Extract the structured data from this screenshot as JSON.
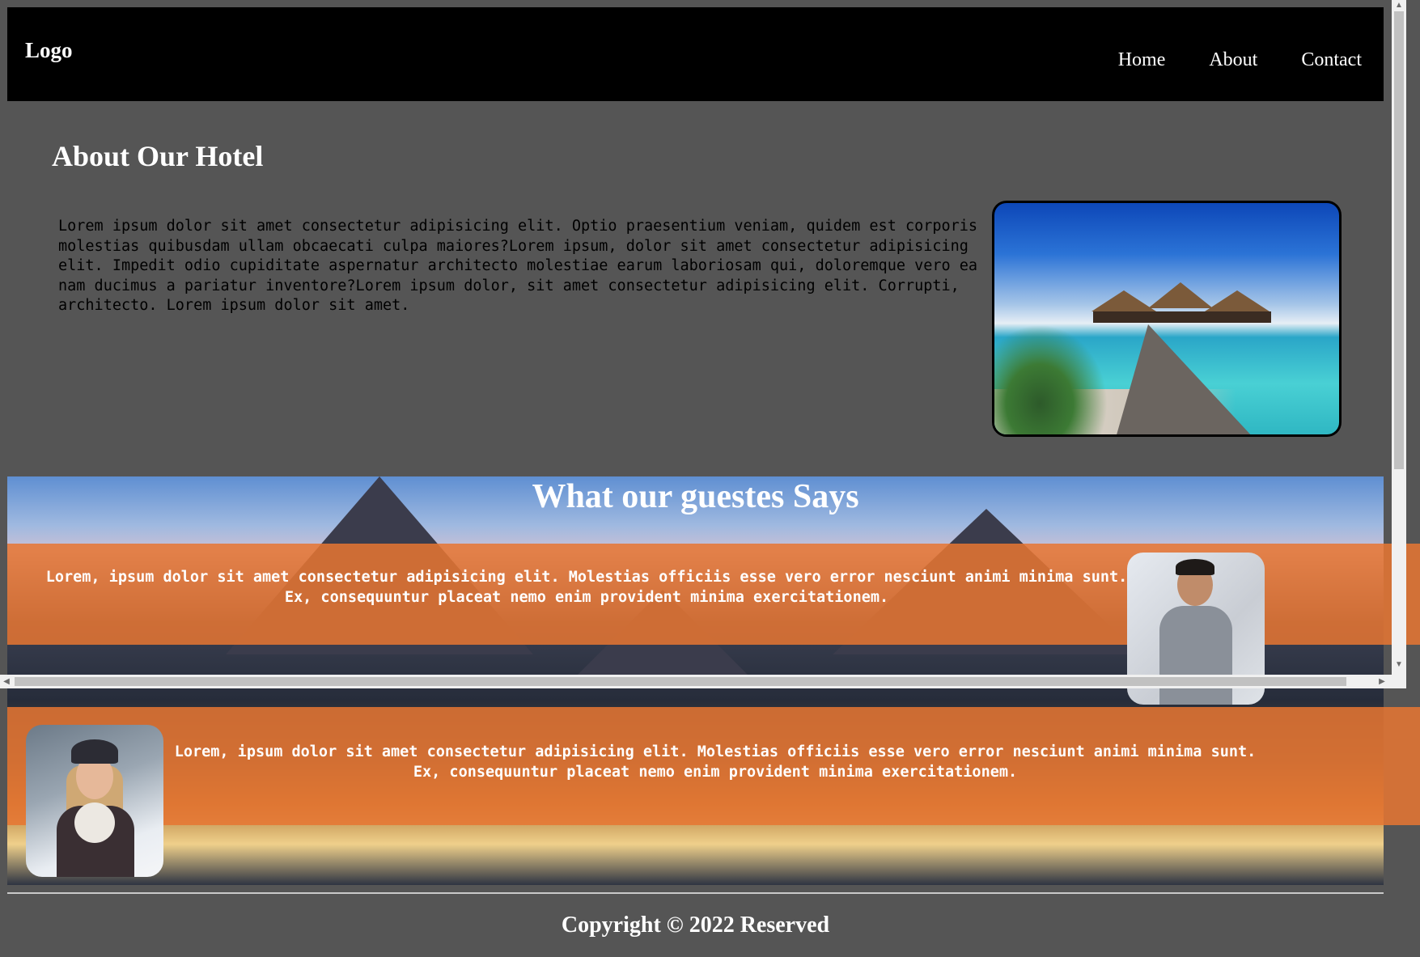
{
  "header": {
    "logo": "Logo",
    "nav": [
      "Home",
      "About",
      "Contact"
    ]
  },
  "about": {
    "title": "About Our Hotel",
    "text": "Lorem ipsum dolor sit amet consectetur adipisicing elit. Optio praesentium veniam, quidem est corporis molestias quibusdam ullam obcaecati culpa maiores?Lorem ipsum, dolor sit amet consectetur adipisicing elit. Impedit odio cupiditate aspernatur architecto molestiae earum laboriosam qui, doloremque vero ea nam ducimus a pariatur inventore?Lorem ipsum dolor, sit amet consectetur adipisicing elit. Corrupti, architecto. Lorem ipsum dolor sit amet."
  },
  "testimonials": {
    "title": "What our guestes Says",
    "items": [
      {
        "text": "Lorem, ipsum dolor sit amet consectetur adipisicing elit. Molestias officiis esse vero error nesciunt animi minima sunt. Ex, consequuntur placeat nemo enim provident minima exercitationem."
      },
      {
        "text": "Lorem, ipsum dolor sit amet consectetur adipisicing elit. Molestias officiis esse vero error nesciunt animi minima sunt. Ex, consequuntur placeat nemo enim provident minima exercitationem."
      }
    ]
  },
  "footer": {
    "copyright": "Copyright © 2022 Reserved"
  },
  "colors": {
    "page_bg": "#555555",
    "header_bg": "#000000",
    "band": "#e67632"
  }
}
